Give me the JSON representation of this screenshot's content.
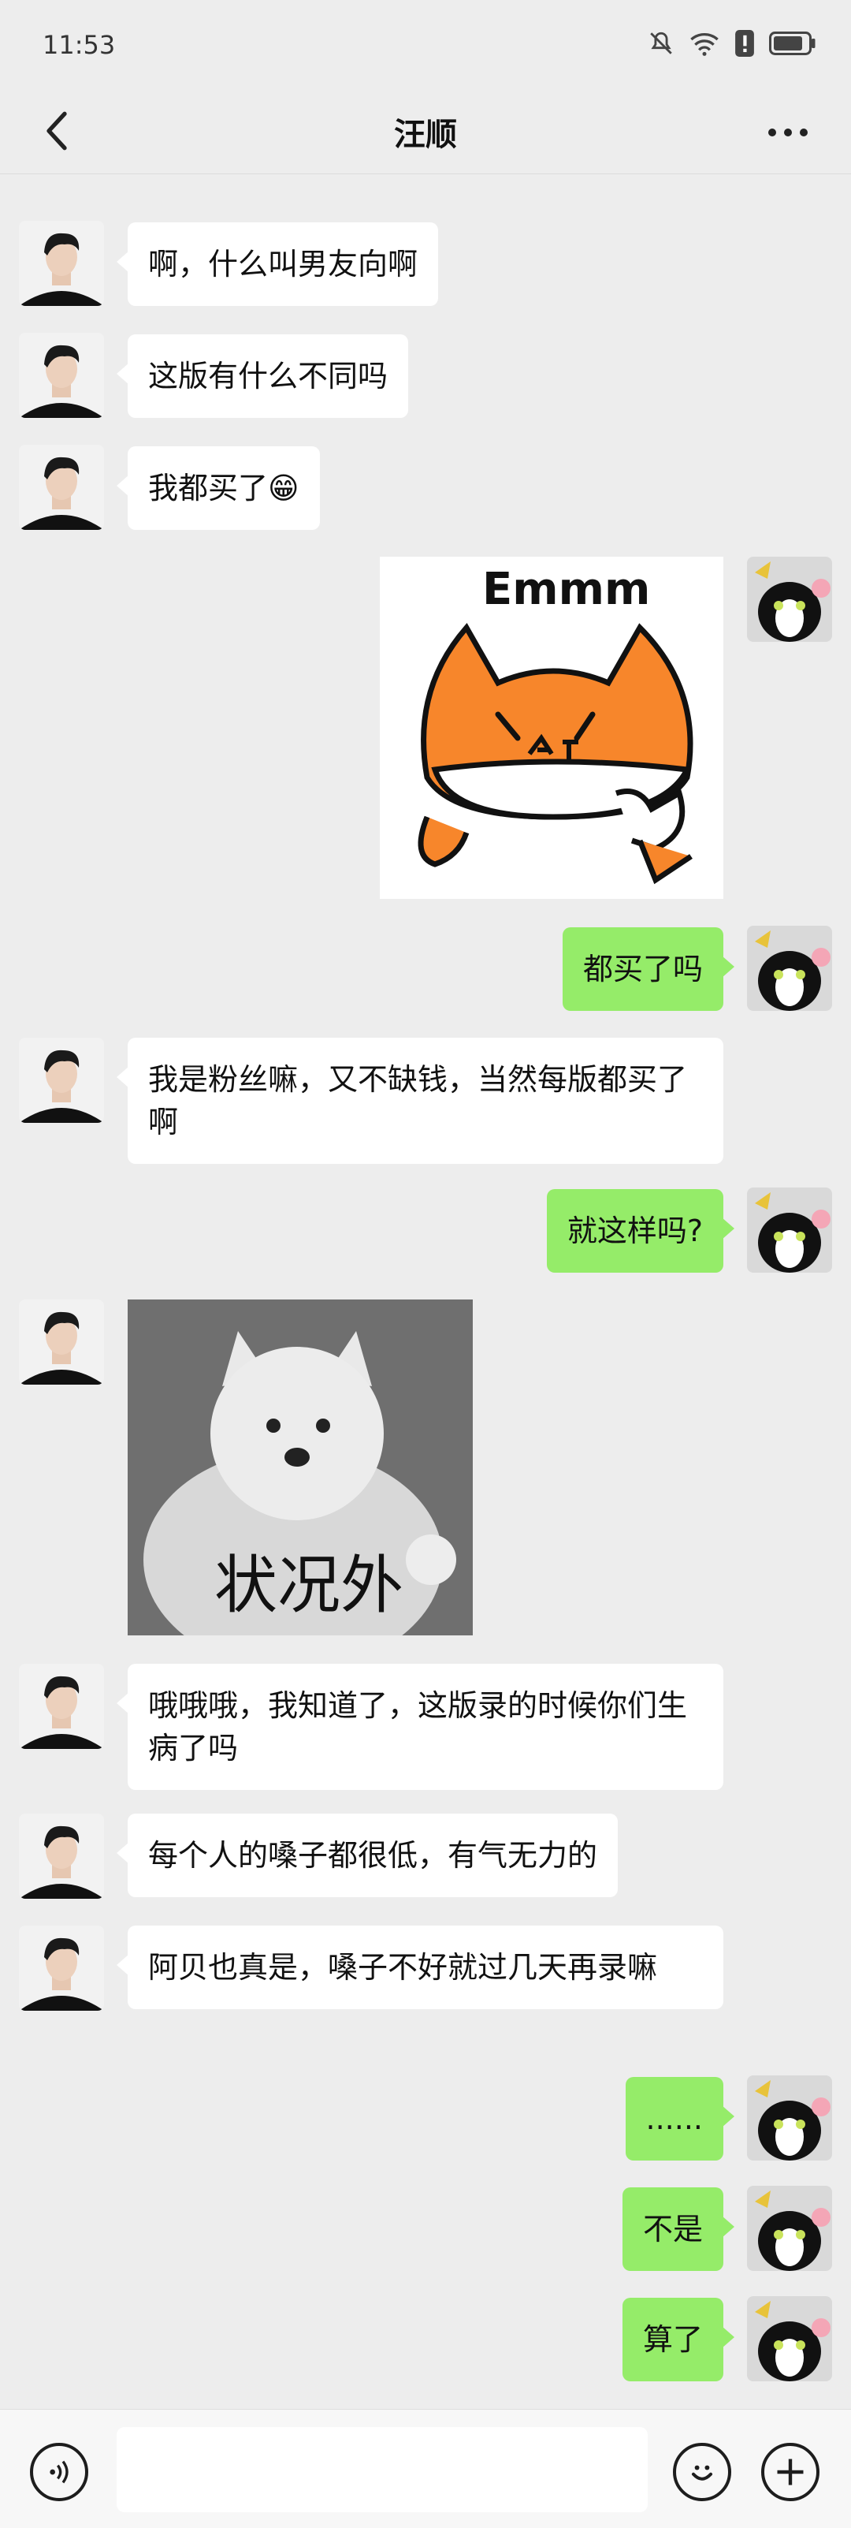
{
  "status": {
    "time": "11:53"
  },
  "header": {
    "title": "汪顺"
  },
  "messages": {
    "m1": "啊，什么叫男友向啊",
    "m2": "这版有什么不同吗",
    "m3": "我都买了",
    "m3_emoji": "😁",
    "sticker1_text": "Emmm",
    "m5": "都买了吗",
    "m6": "我是粉丝嘛，又不缺钱，当然每版都买了啊",
    "m7": "就这样吗?",
    "sticker2_text": "状况外",
    "m9": "哦哦哦，我知道了，这版录的时候你们生病了吗",
    "m10": "每个人的嗓子都很低，有气无力的",
    "m11": "阿贝也真是，嗓子不好就过几天再录嘛",
    "m12": "......",
    "m13": "不是",
    "m14": "算了"
  },
  "colors": {
    "accent": "#95ec69",
    "background": "#ededed"
  },
  "icons": {
    "voice": "voice-icon",
    "emoji": "emoji-icon",
    "plus": "plus-icon"
  }
}
